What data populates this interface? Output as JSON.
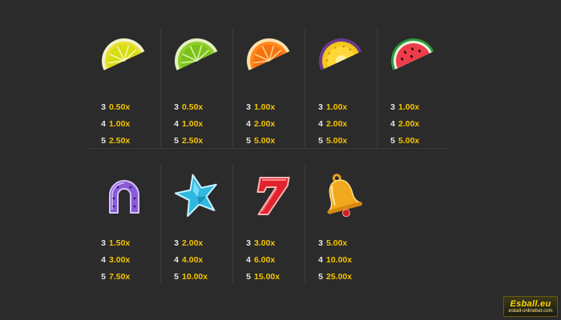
{
  "paytable": {
    "row1": [
      {
        "icon": "lemon-slice-icon",
        "pays": [
          {
            "count": "3",
            "multiplier": "0.50x"
          },
          {
            "count": "4",
            "multiplier": "1.00x"
          },
          {
            "count": "5",
            "multiplier": "2.50x"
          }
        ]
      },
      {
        "icon": "lime-slice-icon",
        "pays": [
          {
            "count": "3",
            "multiplier": "0.50x"
          },
          {
            "count": "4",
            "multiplier": "1.00x"
          },
          {
            "count": "5",
            "multiplier": "2.50x"
          }
        ]
      },
      {
        "icon": "orange-slice-icon",
        "pays": [
          {
            "count": "3",
            "multiplier": "1.00x"
          },
          {
            "count": "4",
            "multiplier": "2.00x"
          },
          {
            "count": "5",
            "multiplier": "5.00x"
          }
        ]
      },
      {
        "icon": "pineapple-slice-icon",
        "pays": [
          {
            "count": "3",
            "multiplier": "1.00x"
          },
          {
            "count": "4",
            "multiplier": "2.00x"
          },
          {
            "count": "5",
            "multiplier": "5.00x"
          }
        ]
      },
      {
        "icon": "watermelon-slice-icon",
        "pays": [
          {
            "count": "3",
            "multiplier": "1.00x"
          },
          {
            "count": "4",
            "multiplier": "2.00x"
          },
          {
            "count": "5",
            "multiplier": "5.00x"
          }
        ]
      }
    ],
    "row2": [
      {
        "icon": "horseshoe-icon",
        "pays": [
          {
            "count": "3",
            "multiplier": "1.50x"
          },
          {
            "count": "4",
            "multiplier": "3.00x"
          },
          {
            "count": "5",
            "multiplier": "7.50x"
          }
        ]
      },
      {
        "icon": "star-icon",
        "pays": [
          {
            "count": "3",
            "multiplier": "2.00x"
          },
          {
            "count": "4",
            "multiplier": "4.00x"
          },
          {
            "count": "5",
            "multiplier": "10.00x"
          }
        ]
      },
      {
        "icon": "seven-icon",
        "pays": [
          {
            "count": "3",
            "multiplier": "3.00x"
          },
          {
            "count": "4",
            "multiplier": "6.00x"
          },
          {
            "count": "5",
            "multiplier": "15.00x"
          }
        ]
      },
      {
        "icon": "bell-icon",
        "pays": [
          {
            "count": "3",
            "multiplier": "5.00x"
          },
          {
            "count": "4",
            "multiplier": "10.00x"
          },
          {
            "count": "5",
            "multiplier": "25.00x"
          }
        ]
      }
    ]
  },
  "watermark": {
    "brand": "Esball",
    "suffix": ".eu",
    "url": "esball-onlinebet.com"
  },
  "colors": {
    "background": "#2b2b2b",
    "multiplier": "#f5c400",
    "count": "#e6e6e6",
    "divider": "#3a3a3a"
  }
}
